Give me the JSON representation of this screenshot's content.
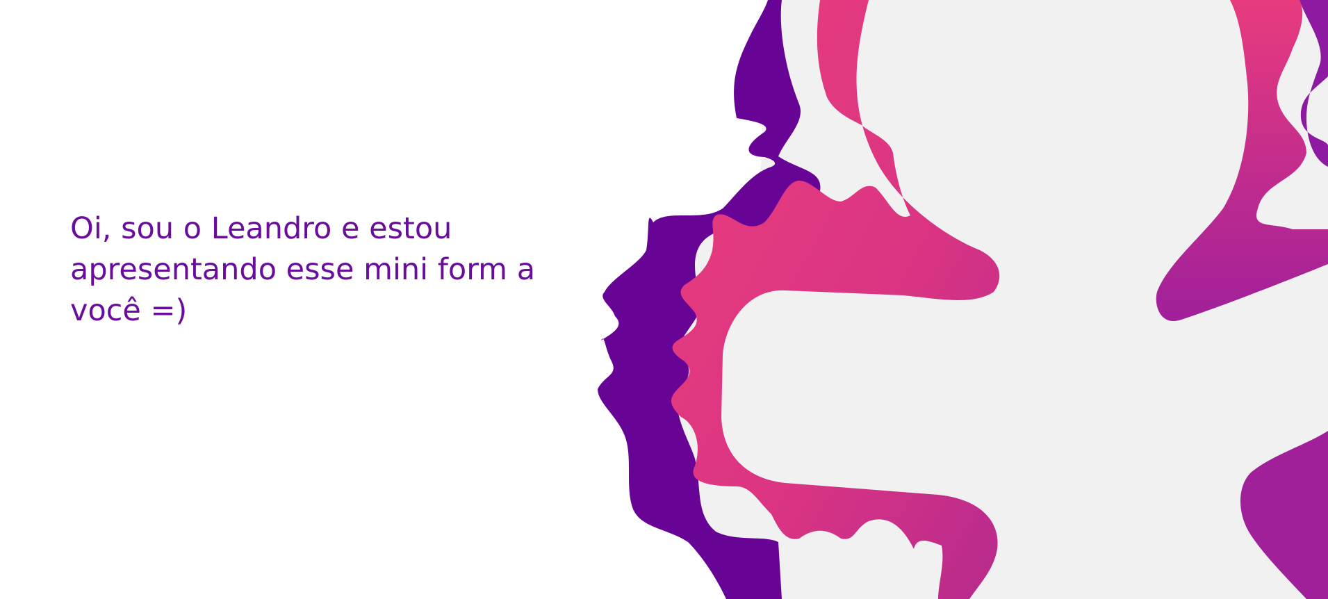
{
  "intro": {
    "text": "Oi, sou o Leandro e estou apresentando esse mini form a você =)"
  },
  "colors": {
    "text": "#6a0c9c",
    "purple": "#670496",
    "pink": "#ea3b7d",
    "magenta": "#b8288c",
    "light_gray": "#f1f1f1",
    "background": "#ffffff"
  },
  "decoration": {
    "icon": "wavy-abstract-shape-icon"
  }
}
